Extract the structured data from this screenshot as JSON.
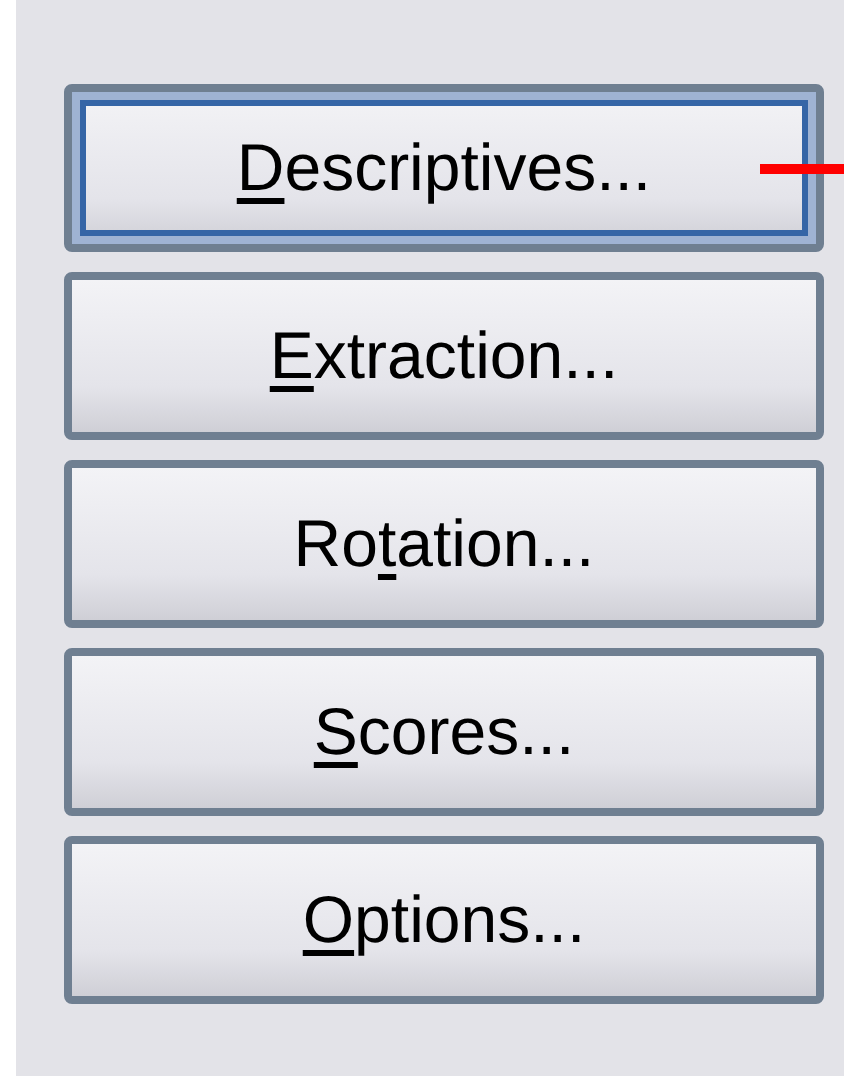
{
  "buttons": [
    {
      "key": "D",
      "after": "escriptives...",
      "selected": true
    },
    {
      "key": "E",
      "after": "xtraction...",
      "selected": false
    },
    {
      "before": "Ro",
      "key": "t",
      "after": "ation...",
      "selected": false
    },
    {
      "key": "S",
      "after": "cores...",
      "selected": false
    },
    {
      "key": "O",
      "after": "ptions...",
      "selected": false
    }
  ]
}
